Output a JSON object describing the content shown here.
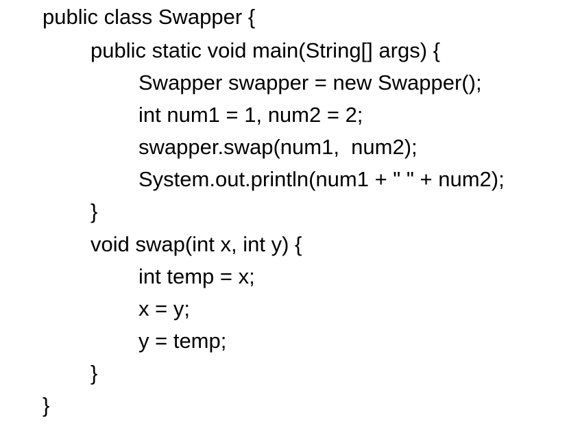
{
  "code": {
    "lines": [
      "public class Swapper {",
      "public static void main(String[] args) {",
      "Swapper swapper = new Swapper();",
      "int num1 = 1, num2 = 2;",
      "swapper.swap(num1,  num2);",
      "System.out.println(num1 + \" \" + num2);",
      "}",
      "void swap(int x, int y) {",
      "int temp = x;",
      "x = y;",
      "y = temp;",
      "}",
      "}"
    ]
  }
}
